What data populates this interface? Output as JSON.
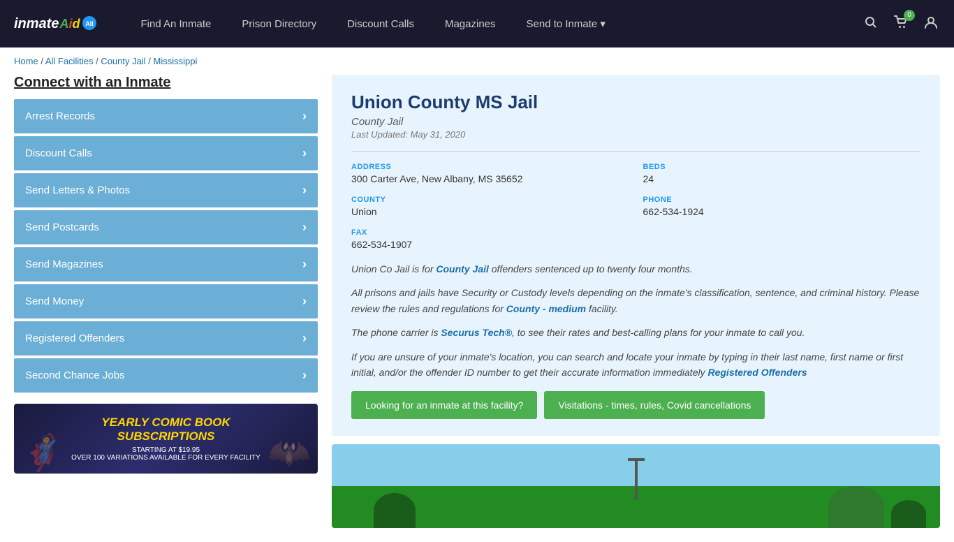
{
  "navbar": {
    "logo_text": "inmate",
    "logo_all": "All",
    "nav_links": [
      {
        "label": "Find An Inmate",
        "id": "find-inmate"
      },
      {
        "label": "Prison Directory",
        "id": "prison-directory"
      },
      {
        "label": "Discount Calls",
        "id": "discount-calls"
      },
      {
        "label": "Magazines",
        "id": "magazines"
      },
      {
        "label": "Send to Inmate ▾",
        "id": "send-to-inmate"
      }
    ],
    "cart_count": "0",
    "search_title": "Search"
  },
  "breadcrumb": {
    "home": "Home",
    "all_facilities": "All Facilities",
    "county_jail": "County Jail",
    "state": "Mississippi"
  },
  "sidebar": {
    "title": "Connect with an Inmate",
    "items": [
      {
        "label": "Arrest Records",
        "id": "arrest-records"
      },
      {
        "label": "Discount Calls",
        "id": "discount-calls"
      },
      {
        "label": "Send Letters & Photos",
        "id": "send-letters"
      },
      {
        "label": "Send Postcards",
        "id": "send-postcards"
      },
      {
        "label": "Send Magazines",
        "id": "send-magazines"
      },
      {
        "label": "Send Money",
        "id": "send-money"
      },
      {
        "label": "Registered Offenders",
        "id": "registered-offenders"
      },
      {
        "label": "Second Chance Jobs",
        "id": "second-chance-jobs"
      }
    ],
    "ad": {
      "title": "Yearly Comic Book\nSubscriptions",
      "subtitle": "Starting at $19.95\nOver 100 variations available for every facility"
    }
  },
  "facility": {
    "name": "Union County MS Jail",
    "type": "County Jail",
    "last_updated": "Last Updated: May 31, 2020",
    "address_label": "ADDRESS",
    "address_value": "300 Carter Ave, New Albany, MS 35652",
    "beds_label": "BEDS",
    "beds_value": "24",
    "county_label": "COUNTY",
    "county_value": "Union",
    "phone_label": "PHONE",
    "phone_value": "662-534-1924",
    "fax_label": "FAX",
    "fax_value": "662-534-1907",
    "desc1": "Union Co Jail is for County Jail offenders sentenced up to twenty four months.",
    "desc2": "All prisons and jails have Security or Custody levels depending on the inmate's classification, sentence, and criminal history. Please review the rules and regulations for County - medium facility.",
    "desc3": "The phone carrier is Securus Tech®, to see their rates and best-calling plans for your inmate to call you.",
    "desc4": "If you are unsure of your inmate's location, you can search and locate your inmate by typing in their last name, first name or first initial, and/or the offender ID number to get their accurate information immediately Registered Offenders",
    "btn1": "Looking for an inmate at this facility?",
    "btn2": "Visitations - times, rules, Covid cancellations"
  }
}
